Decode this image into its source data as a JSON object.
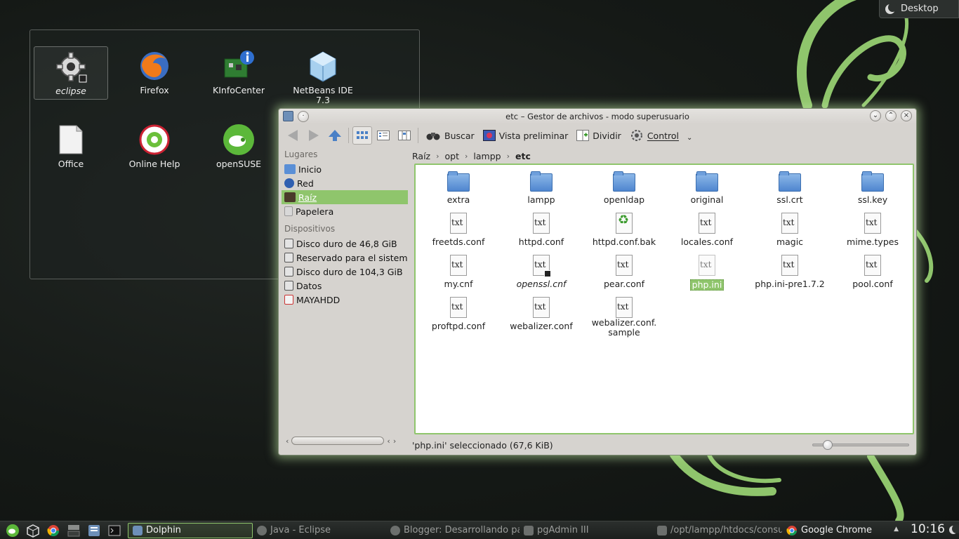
{
  "desktop": {
    "activity_label": "Desktop",
    "icons": [
      {
        "label": "eclipse",
        "icon": "gear-icon"
      },
      {
        "label": "Firefox",
        "icon": "firefox-icon"
      },
      {
        "label": "KInfoCenter",
        "icon": "kinfocenter-icon"
      },
      {
        "label": "NetBeans IDE 7.3",
        "icon": "netbeans-icon"
      },
      {
        "label": "Office",
        "icon": "office-document-icon"
      },
      {
        "label": "Online Help",
        "icon": "lifebuoy-icon"
      },
      {
        "label": "openSUSE",
        "icon": "opensuse-icon"
      }
    ]
  },
  "window": {
    "title": "etc – Gestor de archivos - modo superusuario",
    "toolbar": {
      "search": "Buscar",
      "preview": "Vista preliminar",
      "split": "Dividir",
      "control": "Control"
    },
    "places": {
      "header": "Lugares",
      "items": [
        "Inicio",
        "Red",
        "Raíz",
        "Papelera"
      ],
      "devices_header": "Dispositivos",
      "devices": [
        "Disco duro de 46,8 GiB",
        "Reservado para el sistema",
        "Disco duro de 104,3 GiB",
        "Datos",
        "MAYAHDD"
      ]
    },
    "breadcrumb": [
      "Raíz",
      "opt",
      "lampp",
      "etc"
    ],
    "files": [
      {
        "name": "extra",
        "type": "folder"
      },
      {
        "name": "lampp",
        "type": "folder"
      },
      {
        "name": "openldap",
        "type": "folder"
      },
      {
        "name": "original",
        "type": "folder"
      },
      {
        "name": "ssl.crt",
        "type": "folder"
      },
      {
        "name": "ssl.key",
        "type": "folder"
      },
      {
        "name": "freetds.conf",
        "type": "text"
      },
      {
        "name": "httpd.conf",
        "type": "text"
      },
      {
        "name": "httpd.conf.bak",
        "type": "recycle"
      },
      {
        "name": "locales.conf",
        "type": "text"
      },
      {
        "name": "magic",
        "type": "text"
      },
      {
        "name": "mime.types",
        "type": "text"
      },
      {
        "name": "my.cnf",
        "type": "text"
      },
      {
        "name": "openssl.cnf",
        "type": "link"
      },
      {
        "name": "pear.conf",
        "type": "text"
      },
      {
        "name": "php.ini",
        "type": "text",
        "selected": true
      },
      {
        "name": "php.ini-pre1.7.2",
        "type": "text"
      },
      {
        "name": "pool.conf",
        "type": "text"
      },
      {
        "name": "proftpd.conf",
        "type": "text"
      },
      {
        "name": "webalizer.conf",
        "type": "text"
      },
      {
        "name": "webalizer.conf.sample",
        "type": "text"
      }
    ],
    "status": "'php.ini' seleccionado (67,6 KiB)"
  },
  "taskbar": {
    "tasks": [
      "Dolphin",
      "Java - Eclipse",
      "Blogger: Desarrollando pa",
      "pgAdmin III",
      "/opt/lampp/htdocs/consu",
      "Google Chrome"
    ],
    "clock": "10:16"
  },
  "colors": {
    "accent_green": "#8fc56c",
    "folder_blue": "#4f86cf",
    "taskbar_bg": "#1c1f1d"
  }
}
